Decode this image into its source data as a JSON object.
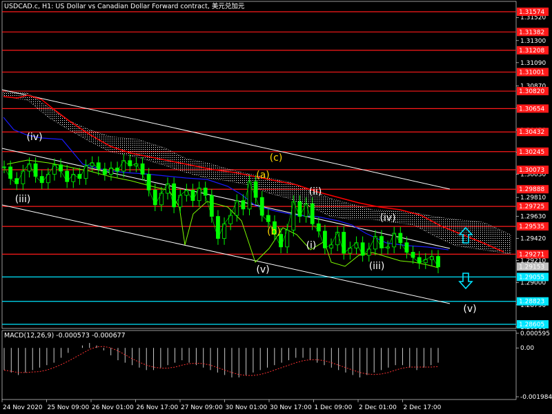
{
  "header": {
    "title": "USDCAD.c, H1:  US Dollar vs Canadian Dollar Forward contract, 美元兑加元"
  },
  "macd_label": "MACD(12,26,9) -0.000573 -0.000677",
  "colors": {
    "background": "#000000",
    "resistance": "#ff1a1a",
    "support": "#00e5ff",
    "candles": "#00ff00",
    "ma_red": "#ff0000",
    "ma_blue": "#1a1aff",
    "wave_yellow": "#ffd700",
    "wave_white": "#ffffff",
    "macd_hist": "#cccccc",
    "macd_signal": "#ff3333"
  },
  "chart_data": [
    {
      "type": "candlestick",
      "symbol": "USDCAD.c",
      "timeframe": "H1",
      "y_ticks": [
        "1.31520",
        "1.31300",
        "1.31090",
        "1.30870",
        "1.30660",
        "1.30450",
        "1.30240",
        "1.30030",
        "1.29810",
        "1.29630",
        "1.29420",
        "1.29210",
        "1.29000",
        "1.28790",
        "1.28580"
      ],
      "resistance_levels": [
        {
          "label": "1.31574",
          "value": 1.31574
        },
        {
          "label": "1.31382",
          "value": 1.31382
        },
        {
          "label": "1.31208",
          "value": 1.31208
        },
        {
          "label": "1.31001",
          "value": 1.31001
        },
        {
          "label": "1.30820",
          "value": 1.3082
        },
        {
          "label": "1.30654",
          "value": 1.30654
        },
        {
          "label": "1.30432",
          "value": 1.30432
        },
        {
          "label": "1.30245",
          "value": 1.30245
        },
        {
          "label": "1.30073",
          "value": 1.30073
        },
        {
          "label": "1.29888",
          "value": 1.29888
        },
        {
          "label": "1.29725",
          "value": 1.29725
        },
        {
          "label": "1.29535",
          "value": 1.29535
        },
        {
          "label": "1.29271",
          "value": 1.29271
        }
      ],
      "support_levels": [
        {
          "label": "1.29055",
          "value": 1.29055
        },
        {
          "label": "1.28823",
          "value": 1.28823
        },
        {
          "label": "1.28605",
          "value": 1.28605
        }
      ],
      "current_price": {
        "label": "1.29153",
        "value": 1.29153
      },
      "x_labels": [
        "24 Nov 2020",
        "25 Nov 09:00",
        "26 Nov 01:00",
        "26 Nov 17:00",
        "27 Nov 09:00",
        "30 Nov 01:00",
        "30 Nov 17:00",
        "1 Dec 09:00",
        "2 Dec 01:00",
        "2 Dec 17:00"
      ],
      "wave_labels": [
        {
          "text": "(iv)",
          "color": "white"
        },
        {
          "text": "(iii)",
          "color": "white"
        },
        {
          "text": "(c)",
          "color": "yellow"
        },
        {
          "text": "(a)",
          "color": "yellow"
        },
        {
          "text": "(b)",
          "color": "yellow"
        },
        {
          "text": "(v)",
          "color": "white"
        },
        {
          "text": "(ii)",
          "color": "white"
        },
        {
          "text": "(i)",
          "color": "white"
        },
        {
          "text": "(iv)",
          "color": "white"
        },
        {
          "text": "(iii)",
          "color": "white"
        },
        {
          "text": "(v)",
          "color": "white"
        }
      ],
      "close_path": [
        1.301,
        1.2999,
        1.2994,
        1.3006,
        1.3013,
        1.3001,
        1.2995,
        1.3003,
        1.3012,
        1.3006,
        1.2996,
        1.3003,
        1.2999,
        1.3011,
        1.3014,
        1.3008,
        1.3003,
        1.3009,
        1.3006,
        1.3016,
        1.3011,
        1.3013,
        1.3003,
        1.2988,
        1.2974,
        1.2985,
        1.2994,
        1.2972,
        1.2983,
        1.2988,
        1.2978,
        1.299,
        1.2983,
        1.2963,
        1.2942,
        1.2956,
        1.2964,
        1.2978,
        1.297,
        1.2996,
        1.2981,
        1.2964,
        1.2958,
        1.2946,
        1.2934,
        1.295,
        1.2977,
        1.2963,
        1.2975,
        1.2956,
        1.2949,
        1.2933,
        1.2936,
        1.2948,
        1.2928,
        1.2933,
        1.2938,
        1.2926,
        1.2932,
        1.2944,
        1.2933,
        1.2934,
        1.2947,
        1.2938,
        1.2929,
        1.2924,
        1.2919,
        1.2922,
        1.2925,
        1.2915
      ]
    },
    {
      "type": "bar",
      "indicator": "MACD(12,26,9)",
      "main": -0.000573,
      "signal": -0.000677,
      "y_ticks": [
        "0.000595",
        "0.00",
        "-0.001984"
      ],
      "hist": [
        -0.0009,
        -0.001,
        -0.0011,
        -0.001,
        -0.0009,
        -0.0008,
        -0.0007,
        -0.0006,
        -0.0004,
        -0.0002,
        0.0,
        0.0001,
        0.0002,
        0.0001,
        -0.0001,
        -0.0003,
        -0.0005,
        -0.0006,
        -0.0007,
        -0.0008,
        -0.0009,
        -0.0009,
        -0.0008,
        -0.0007,
        -0.0006,
        -0.0005,
        -0.0006,
        -0.0007,
        -0.0008,
        -0.0009,
        -0.001,
        -0.0011,
        -0.0012,
        -0.0012,
        -0.0011,
        -0.001,
        -0.0009,
        -0.0008,
        -0.0007,
        -0.0006,
        -0.0005,
        -0.0004,
        -0.0004,
        -0.0005,
        -0.0006,
        -0.0007,
        -0.0008,
        -0.0009,
        -0.001,
        -0.0011,
        -0.0012,
        -0.0011,
        -0.001,
        -0.0009,
        -0.0008,
        -0.0007,
        -0.0007,
        -0.0008,
        -0.0009,
        -0.0008,
        -0.0007,
        -0.0006
      ]
    }
  ]
}
